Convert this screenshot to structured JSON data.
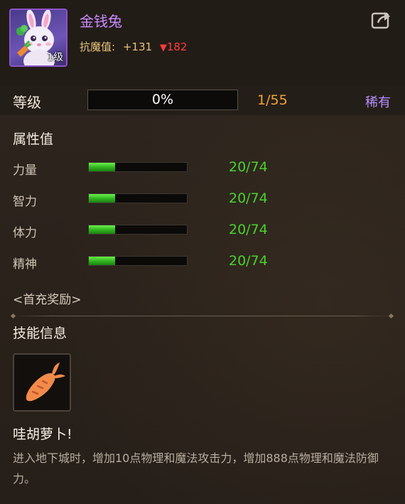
{
  "header": {
    "name": "金钱兔",
    "avatar_level": "1级",
    "resist_label": "抗魔值:",
    "resist_value": "+131",
    "resist_reduction": "182",
    "share_icon": "share-export-icon"
  },
  "level": {
    "label": "等级",
    "progress_text": "0%",
    "progress_fraction": 0,
    "count": "1/55",
    "rarity": "稀有"
  },
  "attributes": {
    "title": "属性值",
    "items": [
      {
        "label": "力量",
        "value": "20/74",
        "fraction": 0.27
      },
      {
        "label": "智力",
        "value": "20/74",
        "fraction": 0.27
      },
      {
        "label": "体力",
        "value": "20/74",
        "fraction": 0.27
      },
      {
        "label": "精神",
        "value": "20/74",
        "fraction": 0.27
      }
    ]
  },
  "first_charge": "<首充奖励>",
  "skill": {
    "title": "技能信息",
    "icon": "carrot-icon",
    "name": "哇胡萝卜!",
    "description": "进入地下城时，增加10点物理和魔法攻击力，增加888点物理和魔法防御力。"
  },
  "colors": {
    "name": "#c98bff",
    "rarity": "#b890ff",
    "count": "#f1a533",
    "stat_value": "#49d32d",
    "reduction": "#ff3b3b"
  }
}
